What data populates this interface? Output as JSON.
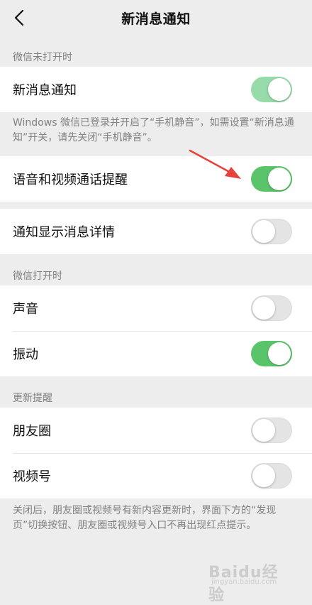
{
  "nav": {
    "title": "新消息通知",
    "back_icon": "chevron-left-icon"
  },
  "section_closed": {
    "label": "微信未打开时",
    "new_message": {
      "label": "新消息通知",
      "state": "on"
    },
    "note": "Windows 微信已登录并开启了“手机静音”，如需设置“新消息通知”开关，请先关闭“手机静音”。"
  },
  "call_reminder": {
    "label": "语音和视频通话提醒",
    "state": "on"
  },
  "show_details": {
    "label": "通知显示消息详情",
    "state": "off"
  },
  "section_open": {
    "label": "微信打开时",
    "sound": {
      "label": "声音",
      "state": "off"
    },
    "vibrate": {
      "label": "振动",
      "state": "on"
    }
  },
  "section_update": {
    "label": "更新提醒",
    "moments": {
      "label": "朋友圈",
      "state": "off"
    },
    "channels": {
      "label": "视频号",
      "state": "off"
    },
    "note": "关闭后，朋友圈或视频号有新内容更新时，界面下方的“发现页”切换按钮、朋友圈或视频号入口不再出现红点提示。"
  },
  "annotation": {
    "arrow_color": "#e8403a"
  },
  "watermark": {
    "text": "Baidu经验",
    "sub": "jingyan.baidu.com"
  },
  "colors": {
    "toggle_on": "#5ac46b",
    "toggle_on_faded": "#97dbaa",
    "toggle_off": "#e4e4e4",
    "background": "#ededed"
  }
}
